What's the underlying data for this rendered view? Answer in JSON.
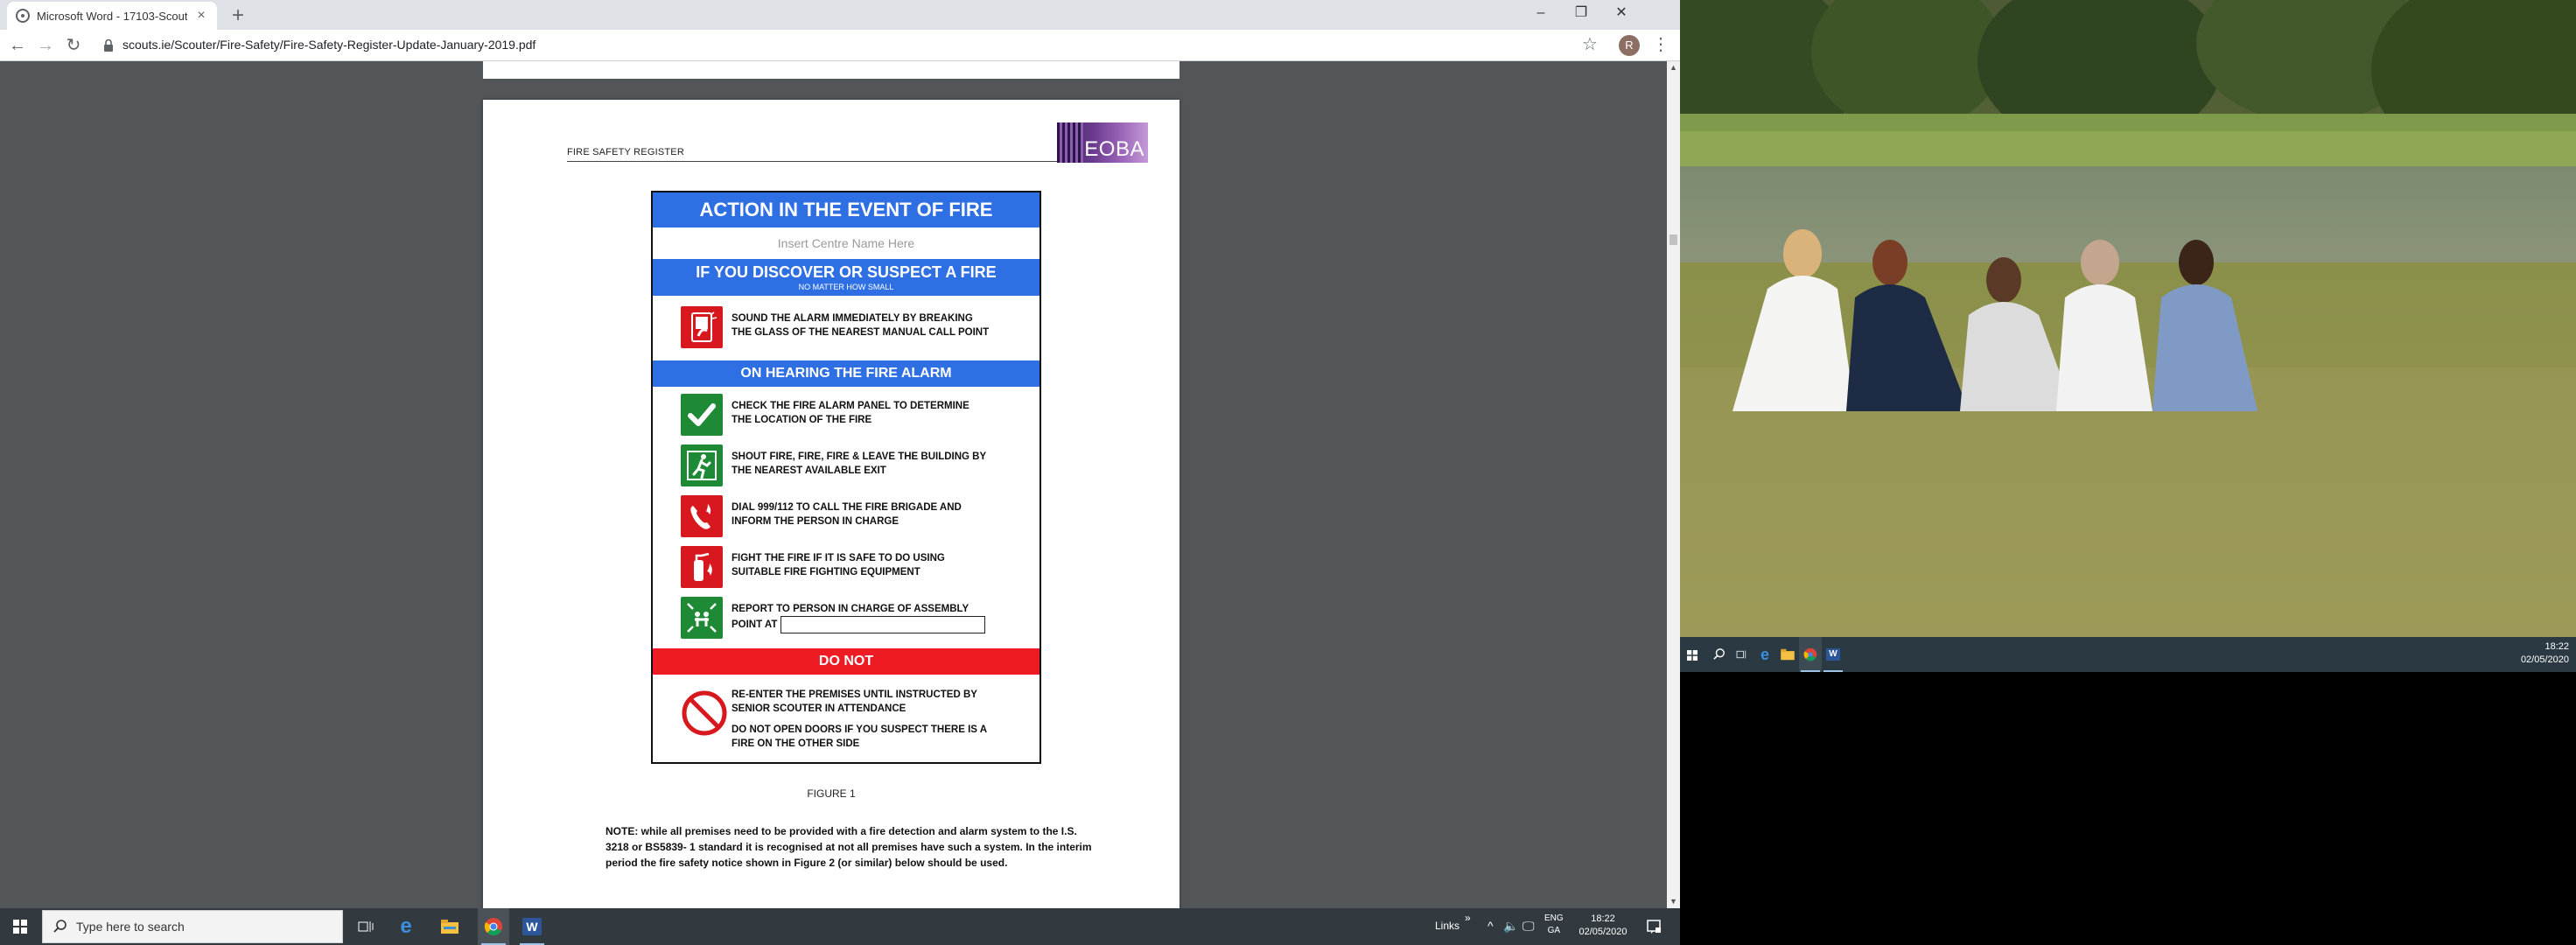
{
  "browser": {
    "tab_title": "Microsoft Word - 17103-Scouti...",
    "new_tab": "+",
    "url": "scouts.ie/Scouter/Fire-Safety/Fire-Safety-Register-Update-January-2019.pdf",
    "profile_initial": "R"
  },
  "document": {
    "header_text": "FIRE SAFETY REGISTER",
    "logo_text": "EOBA",
    "notice": {
      "title": "ACTION IN THE EVENT OF FIRE",
      "centre_placeholder": "Insert Centre Name Here",
      "discover_heading": "IF YOU DISCOVER OR SUSPECT A FIRE",
      "discover_subheading": "NO MATTER HOW SMALL",
      "discover_step": [
        "SOUND THE ALARM IMMEDIATELY BY BREAKING",
        "THE GLASS OF THE NEAREST MANUAL CALL POINT"
      ],
      "hearing_heading": "ON HEARING THE FIRE ALARM",
      "steps": [
        {
          "line1": "CHECK THE FIRE ALARM PANEL TO DETERMINE",
          "line2": "THE LOCATION OF THE FIRE",
          "icon": "checkmark-icon",
          "color": "#1f8a36"
        },
        {
          "line1": "SHOUT FIRE, FIRE, FIRE & LEAVE THE BUILDING BY",
          "line2": "THE NEAREST AVAILABLE EXIT",
          "icon": "running-exit-icon",
          "color": "#1f8a36"
        },
        {
          "line1": "DIAL 999/112 TO CALL THE FIRE BRIGADE AND",
          "line2": "INFORM THE PERSON IN CHARGE",
          "icon": "fire-phone-icon",
          "color": "#d7191f"
        },
        {
          "line1": "FIGHT THE FIRE IF IT IS SAFE TO DO USING",
          "line2": "SUITABLE FIRE FIGHTING EQUIPMENT",
          "icon": "extinguisher-icon",
          "color": "#d7191f"
        },
        {
          "line1": "REPORT TO PERSON IN CHARGE OF ASSEMBLY",
          "line2": "POINT AT",
          "icon": "assembly-point-icon",
          "color": "#1f8a36"
        }
      ],
      "donot_heading": "DO NOT",
      "donot_lines": [
        [
          "RE-ENTER THE PREMISES UNTIL INSTRUCTED BY",
          "SENIOR SCOUTER IN ATTENDANCE"
        ],
        [
          "DO NOT OPEN DOORS IF YOU SUSPECT THERE IS A",
          "FIRE ON THE OTHER SIDE"
        ]
      ]
    },
    "figure_caption": "FIGURE 1",
    "note": [
      "NOTE: while all premises need to be provided with a fire detection and alarm system to the I.S.",
      "3218 or BS5839- 1 standard it is recognised at not all premises have such a system.  In the interim",
      "period the fire safety notice shown in Figure 2 (or similar) below should be used."
    ]
  },
  "taskbar_left": {
    "search_placeholder": "Type here to search",
    "links": "Links",
    "lang": [
      "ENG",
      "GA"
    ],
    "time": "18:22",
    "date": "02/05/2020"
  },
  "taskbar_right": {
    "time": "18:22",
    "date": "02/05/2020"
  }
}
